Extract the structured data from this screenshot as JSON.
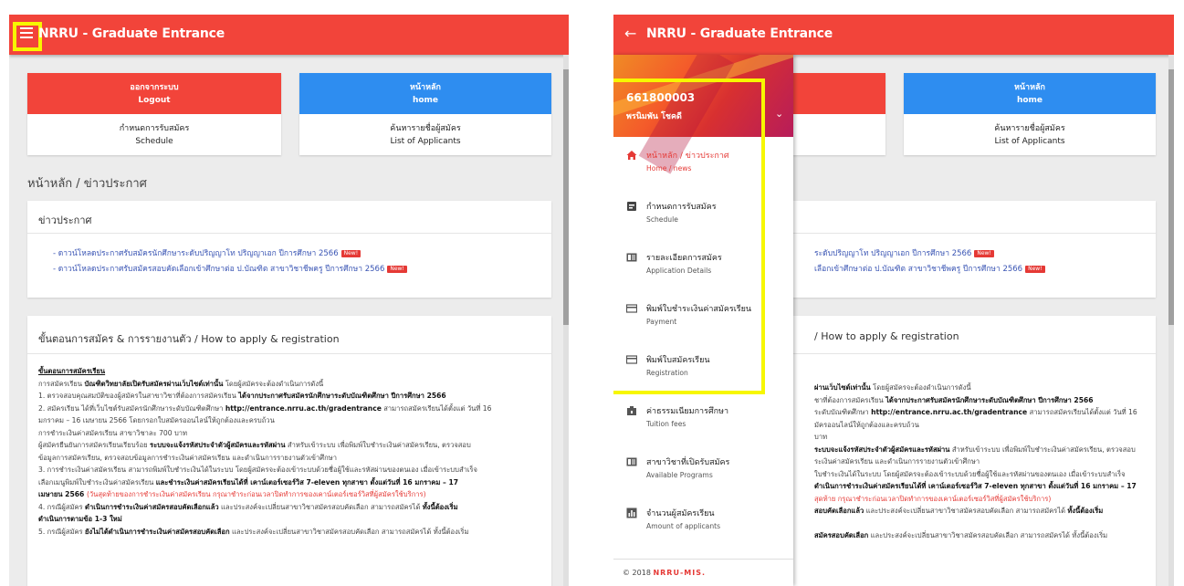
{
  "app_title": "NRRU - Graduate Entrance",
  "buttons": {
    "logout_th": "ออกจากระบบ",
    "logout_en": "Logout",
    "home_th": "หน้าหลัก",
    "home_en": "home",
    "schedule_th": "กำหนดการรับสมัคร",
    "schedule_en": "Schedule",
    "applicants_th": "ค้นหารายชื่อผู้สมัคร",
    "applicants_en": "List of Applicants"
  },
  "breadcrumb": "หน้าหลัก / ข่าวประกาศ",
  "news": {
    "title": "ข่าวประกาศ",
    "items": [
      "- ดาวน์โหลดประกาศรับสมัครนักศึกษาระดับปริญญาโท ปริญญาเอก ปีการศึกษา 2566",
      "- ดาวน์โหลดประกาศรับสมัครสอบคัดเลือกเข้าศึกษาต่อ ป.บัณฑิต สาขาวิชาชีพครู ปีการศึกษา 2566"
    ],
    "new_badge": "New!"
  },
  "howto": {
    "title": "ขั้นตอนการสมัคร & การรายงานตัว / How to apply & registration",
    "section": "ขั้นตอนการสมัครเรียน",
    "l0a": "การสมัครเรียน ",
    "l0b": "บัณฑิตวิทยาลัยเปิดรับสมัครผ่านเว็บไซต์เท่านั้น",
    "l0c": " โดยผู้สมัครจะต้องดำเนินการดังนี้",
    "l1a": "1. ตรวจสอบคุณสมบัติของผู้สมัครในสาขาวิชาที่ต้องการสมัครเรียน ",
    "l1b": "ได้จากประกาศรับสมัครนักศึกษาระดับบัณฑิตศึกษา ปีการศึกษา 2566",
    "l2a": "2. สมัครเรียน ได้ที่เว็บไซต์รับสมัครนักศึกษาระดับบัณฑิตศึกษา ",
    "l2b": "http://entrance.nrru.ac.th/gradentrance",
    "l2c": " สามารถสมัครเรียนได้ตั้งแต่ วันที่ 16",
    "l3": "มกราคม – 16 เมษายน 2566 โดยกรอกใบสมัครออนไลน์ให้ถูกต้องและครบถ้วน",
    "l4": "การชำระเงินค่าสมัครเรียน สาขาวิชาละ 700 บาท",
    "l5a": "ผู้สมัครยืนยันการสมัครเรียนเรียบร้อย ",
    "l5b": "ระบบจะแจ้งรหัสประจำตัวผู้สมัครและรหัสผ่าน",
    "l5c": " สำหรับเข้าระบบ เพื่อพิมพ์ใบชำระเงินค่าสมัครเรียน, ตรวจสอบ",
    "l6": "ข้อมูลการสมัครเรียน, ตรวจสอบข้อมูลการชำระเงินค่าสมัครเรียน และดำเนินการรายงานตัวเข้าศึกษา",
    "l7": "3. การชำระเงินค่าสมัครเรียน สามารถพิมพ์ใบชำระเงินได้ในระบบ โดยผู้สมัครจะต้องเข้าระบบด้วยชื่อผู้ใช้และรหัสผ่านของตนเอง เมื่อเข้าระบบสำเร็จ",
    "l8a": "เลือกเมนูพิมพ์ใบชำระเงินค่าสมัครเรียน ",
    "l8b": "และชำระเงินค่าสมัครเรียนได้ที่ เคาน์เตอร์เซอร์วิส 7-eleven ทุกสาขา ตั้งแต่วันที่ 16 มกราคม – 17",
    "l9a": "เมษายน 2566 ",
    "l9b": "(วันสุดท้ายของการชำระเงินค่าสมัครเรียน กรุณาชำระก่อนเวลาปิดทำการของเคาน์เตอร์เซอร์วิสที่ผู้สมัครใช้บริการ)",
    "l10a": "4. กรณีผู้สมัคร ",
    "l10b": "ดำเนินการชำระเงินค่าสมัครสอบคัดเลือกแล้ว",
    "l10c": " และประสงค์จะเปลี่ยนสาขาวิชาสมัครสอบคัดเลือก สามารถสมัครได้ ",
    "l10d": "ทั้งนี้ต้องเริ่ม",
    "l11": "ดำเนินการตามข้อ 1-3 ใหม่",
    "l12a": "5. กรณีผู้สมัคร ",
    "l12b": "ยังไม่ได้ดำเนินการชำระเงินค่าสมัครสอบคัดเลือก",
    "l12c": " และประสงค์จะเปลี่ยนสาขาวิชาสมัครสอบคัดเลือก สามารถสมัครได้ ทั้งนี้ต้องเริ่ม"
  },
  "drawer": {
    "user_id": "661800003",
    "user_name": "พรนิมพัน โชคดี",
    "items": [
      {
        "th": "หน้าหลัก / ข่าวประกาศ",
        "en": "Home / news",
        "icon": "home-icon"
      },
      {
        "th": "กำหนดการรับสมัคร",
        "en": "Schedule",
        "icon": "calendar-icon"
      },
      {
        "th": "รายละเอียดการสมัคร",
        "en": "Application Details",
        "icon": "details-icon"
      },
      {
        "th": "พิมพ์ใบชำระเงินค่าสมัครเรียน",
        "en": "Payment",
        "icon": "card-icon"
      },
      {
        "th": "พิมพ์ใบสมัครเรียน",
        "en": "Registration",
        "icon": "card-icon"
      },
      {
        "th": "ค่าธรรมเนียมการศึกษา",
        "en": "Tuition fees",
        "icon": "tuition-icon"
      },
      {
        "th": "สาขาวิชาที่เปิดรับสมัคร",
        "en": "Available Programs",
        "icon": "programs-icon"
      },
      {
        "th": "จำนวนผู้สมัครเรียน",
        "en": "Amount of applicants",
        "icon": "chart-icon"
      }
    ],
    "footer_prefix": "© 2018 ",
    "footer_brand": "NRRU-MIS."
  },
  "right_partial": {
    "breadcrumb_tail": "",
    "howto_tail": "/ How to apply & registration",
    "news1_tail": "ระดับปริญญาโท ปริญญาเอก ปีการศึกษา 2566",
    "news2_tail": "เลือกเข้าศึกษาต่อ ป.บัณฑิต สาขาวิชาชีพครู ปีการศึกษา 2566"
  },
  "colors": {
    "primary": "#f2443a",
    "accent_blue": "#2e8df0",
    "highlight": "#f7f700"
  }
}
